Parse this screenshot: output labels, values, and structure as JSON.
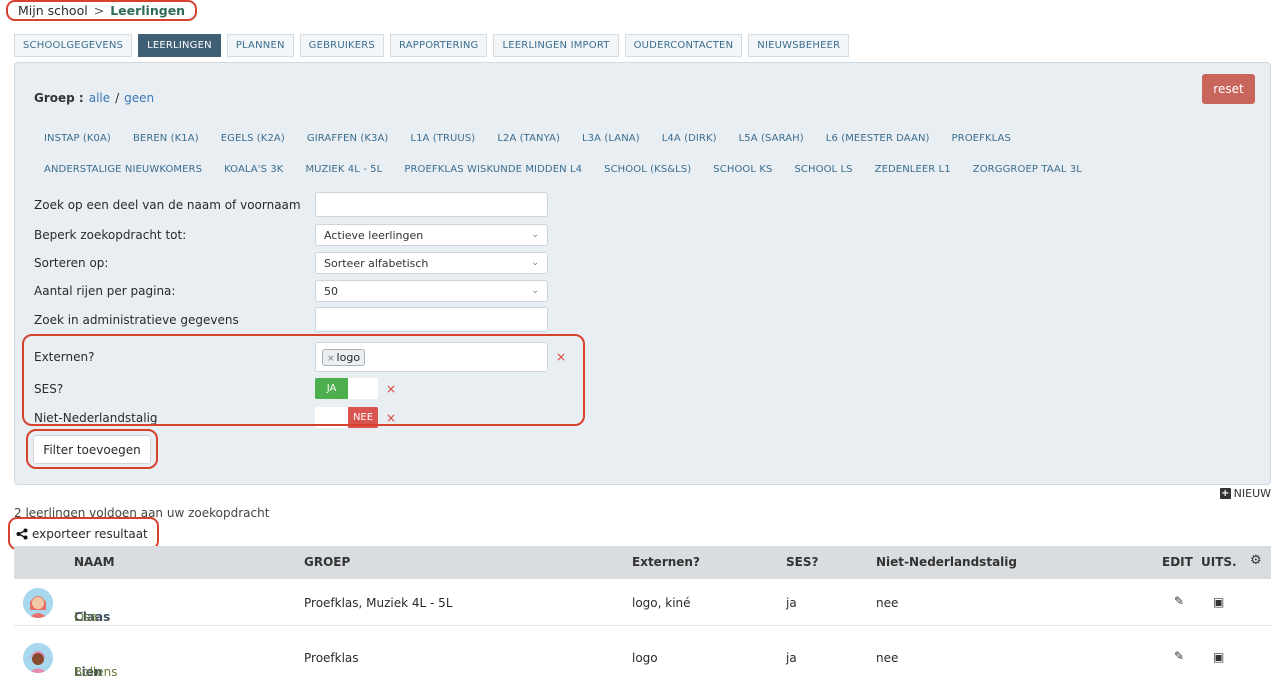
{
  "breadcrumb": {
    "root": "Mijn school",
    "separator": ">",
    "current": "Leerlingen"
  },
  "tabs": [
    {
      "label": "SCHOOLGEGEVENS",
      "active": false
    },
    {
      "label": "LEERLINGEN",
      "active": true
    },
    {
      "label": "PLANNEN",
      "active": false
    },
    {
      "label": "GEBRUIKERS",
      "active": false
    },
    {
      "label": "RAPPORTERING",
      "active": false
    },
    {
      "label": "LEERLINGEN IMPORT",
      "active": false
    },
    {
      "label": "OUDERCONTACTEN",
      "active": false
    },
    {
      "label": "NIEUWSBEHEER",
      "active": false
    }
  ],
  "filter": {
    "reset_label": "reset",
    "group_label": "Groep :",
    "group_all": "alle",
    "group_slash": "/",
    "group_none": "geen",
    "groups_row1": [
      "INSTAP (K0A)",
      "BEREN (K1A)",
      "EGELS (K2A)",
      "GIRAFFEN (K3A)",
      "L1A (TRUUS)",
      "L2A (TANYA)",
      "L3A (LANA)",
      "L4A (DIRK)",
      "L5A (SARAH)",
      "L6 (MEESTER DAAN)",
      "PROEFKLAS"
    ],
    "groups_row2": [
      "ANDERSTALIGE NIEUWKOMERS",
      "KOALA'S 3K",
      "MUZIEK 4L - 5L",
      "PROEFKLAS WISKUNDE MIDDEN L4",
      "SCHOOL (KS&LS)",
      "SCHOOL KS",
      "SCHOOL LS",
      "ZEDENLEER L1",
      "ZORGGROEP TAAL 3L"
    ],
    "name_search_label": "Zoek op een deel van de naam of voornaam",
    "name_search_value": "",
    "limit_label": "Beperk zoekopdracht tot:",
    "limit_value": "Actieve leerlingen",
    "sort_label": "Sorteren op:",
    "sort_value": "Sorteer alfabetisch",
    "rows_label": "Aantal rijen per pagina:",
    "rows_value": "50",
    "admin_search_label": "Zoek in administratieve gegevens",
    "admin_search_value": "",
    "externen_label": "Externen?",
    "externen_tag": "logo",
    "ses_label": "SES?",
    "ses_value": "JA",
    "nnl_label": "Niet-Nederlandstalig",
    "nnl_value": "NEE",
    "add_filter_label": "Filter toevoegen",
    "remove_symbol": "×",
    "tag_remove_symbol": "×"
  },
  "results": {
    "new_label": "NIEUW",
    "count_text": "2 leerlingen voldoen aan uw zoekopdracht",
    "export_label": "exporteer resultaat"
  },
  "table": {
    "headers": {
      "name": "NAAM",
      "group": "GROEP",
      "externen": "Externen?",
      "ses": "SES?",
      "nnl": "Niet-Nederlandstalig",
      "edit": "EDIT",
      "archive": "UITS."
    },
    "rows": [
      {
        "last": "Claas",
        "first": "Lisa",
        "group": "Proefklas, Muziek 4L - 5L",
        "externen": "logo, kiné",
        "ses": "ja",
        "nnl": "nee"
      },
      {
        "last": "Lien",
        "first": "Bollens",
        "group": "Proefklas",
        "externen": "logo",
        "ses": "ja",
        "nnl": "nee"
      }
    ]
  },
  "colors": {
    "accent": "#3e5f74",
    "danger": "#d9412f",
    "success": "#4cae4c",
    "reset": "#c9665c"
  }
}
